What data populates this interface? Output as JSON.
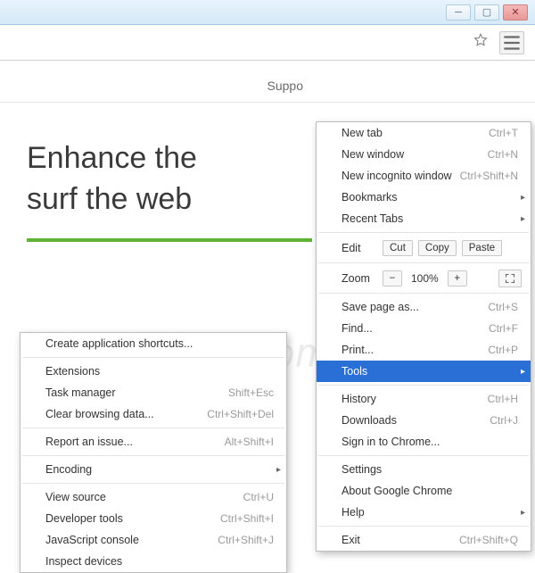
{
  "page": {
    "nav_support": "Suppo",
    "hero_line1": "Enhance the",
    "hero_line2": "surf the web",
    "watermark": "riskom"
  },
  "main_menu": [
    {
      "type": "item",
      "label": "New tab",
      "shortcut": "Ctrl+T"
    },
    {
      "type": "item",
      "label": "New window",
      "shortcut": "Ctrl+N"
    },
    {
      "type": "item",
      "label": "New incognito window",
      "shortcut": "Ctrl+Shift+N"
    },
    {
      "type": "item",
      "label": "Bookmarks",
      "sub": true
    },
    {
      "type": "item",
      "label": "Recent Tabs",
      "sub": true
    },
    {
      "type": "sep"
    },
    {
      "type": "edit",
      "label": "Edit",
      "cut": "Cut",
      "copy": "Copy",
      "paste": "Paste"
    },
    {
      "type": "sep"
    },
    {
      "type": "zoom",
      "label": "Zoom",
      "minus": "−",
      "value": "100%",
      "plus": "+"
    },
    {
      "type": "sep"
    },
    {
      "type": "item",
      "label": "Save page as...",
      "shortcut": "Ctrl+S"
    },
    {
      "type": "item",
      "label": "Find...",
      "shortcut": "Ctrl+F"
    },
    {
      "type": "item",
      "label": "Print...",
      "shortcut": "Ctrl+P"
    },
    {
      "type": "item",
      "label": "Tools",
      "sub": true,
      "highlighted": true
    },
    {
      "type": "sep"
    },
    {
      "type": "item",
      "label": "History",
      "shortcut": "Ctrl+H"
    },
    {
      "type": "item",
      "label": "Downloads",
      "shortcut": "Ctrl+J"
    },
    {
      "type": "item",
      "label": "Sign in to Chrome..."
    },
    {
      "type": "sep"
    },
    {
      "type": "item",
      "label": "Settings"
    },
    {
      "type": "item",
      "label": "About Google Chrome"
    },
    {
      "type": "item",
      "label": "Help",
      "sub": true
    },
    {
      "type": "sep"
    },
    {
      "type": "item",
      "label": "Exit",
      "shortcut": "Ctrl+Shift+Q"
    }
  ],
  "sub_menu": [
    {
      "type": "item",
      "label": "Create application shortcuts..."
    },
    {
      "type": "sep"
    },
    {
      "type": "item",
      "label": "Extensions"
    },
    {
      "type": "item",
      "label": "Task manager",
      "shortcut": "Shift+Esc"
    },
    {
      "type": "item",
      "label": "Clear browsing data...",
      "shortcut": "Ctrl+Shift+Del"
    },
    {
      "type": "sep"
    },
    {
      "type": "item",
      "label": "Report an issue...",
      "shortcut": "Alt+Shift+I"
    },
    {
      "type": "sep"
    },
    {
      "type": "item",
      "label": "Encoding",
      "sub": true
    },
    {
      "type": "sep"
    },
    {
      "type": "item",
      "label": "View source",
      "shortcut": "Ctrl+U"
    },
    {
      "type": "item",
      "label": "Developer tools",
      "shortcut": "Ctrl+Shift+I"
    },
    {
      "type": "item",
      "label": "JavaScript console",
      "shortcut": "Ctrl+Shift+J"
    },
    {
      "type": "item",
      "label": "Inspect devices"
    }
  ]
}
